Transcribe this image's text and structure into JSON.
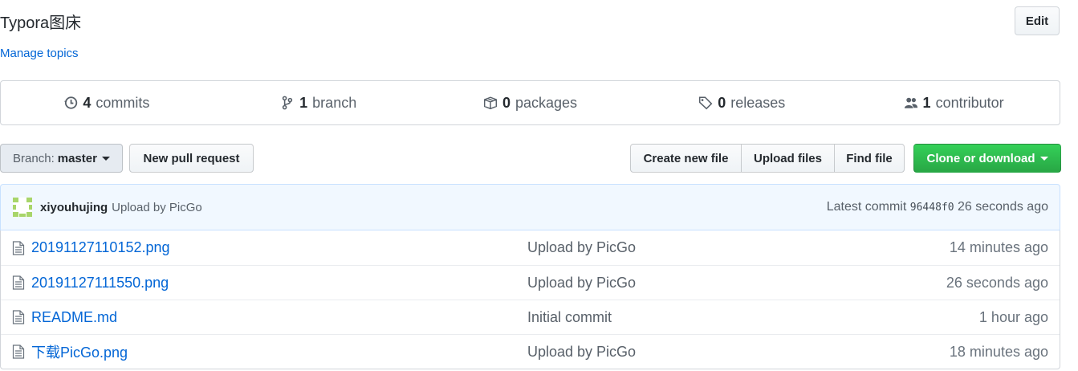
{
  "repo": {
    "description": "Typora图床",
    "manage_topics": "Manage topics",
    "edit_label": "Edit"
  },
  "summary": {
    "commits": {
      "count": "4",
      "label": "commits"
    },
    "branch": {
      "count": "1",
      "label": "branch"
    },
    "packages": {
      "count": "0",
      "label": "packages"
    },
    "releases": {
      "count": "0",
      "label": "releases"
    },
    "contributor": {
      "count": "1",
      "label": "contributor"
    }
  },
  "toolbar": {
    "branch_prefix": "Branch:",
    "branch_name": "master",
    "new_pr": "New pull request",
    "create_file": "Create new file",
    "upload_files": "Upload files",
    "find_file": "Find file",
    "clone": "Clone or download"
  },
  "latest_commit": {
    "author": "xiyouhujing",
    "message": "Upload by PicGo",
    "label": "Latest commit",
    "sha": "96448f0",
    "age": "26 seconds ago"
  },
  "files": [
    {
      "name": "20191127110152.png",
      "message": "Upload by PicGo",
      "age": "14 minutes ago"
    },
    {
      "name": "20191127111550.png",
      "message": "Upload by PicGo",
      "age": "26 seconds ago"
    },
    {
      "name": "README.md",
      "message": "Initial commit",
      "age": "1 hour ago"
    },
    {
      "name": "下载PicGo.png",
      "message": "Upload by PicGo",
      "age": "18 minutes ago"
    }
  ],
  "colors": {
    "link": "#0366d6",
    "clone_green": "#28a745",
    "commit_bar_bg": "#f1f8ff"
  },
  "icons": [
    "history-icon",
    "git-branch-icon",
    "package-icon",
    "tag-icon",
    "people-icon",
    "file-icon",
    "avatar-identicon"
  ]
}
